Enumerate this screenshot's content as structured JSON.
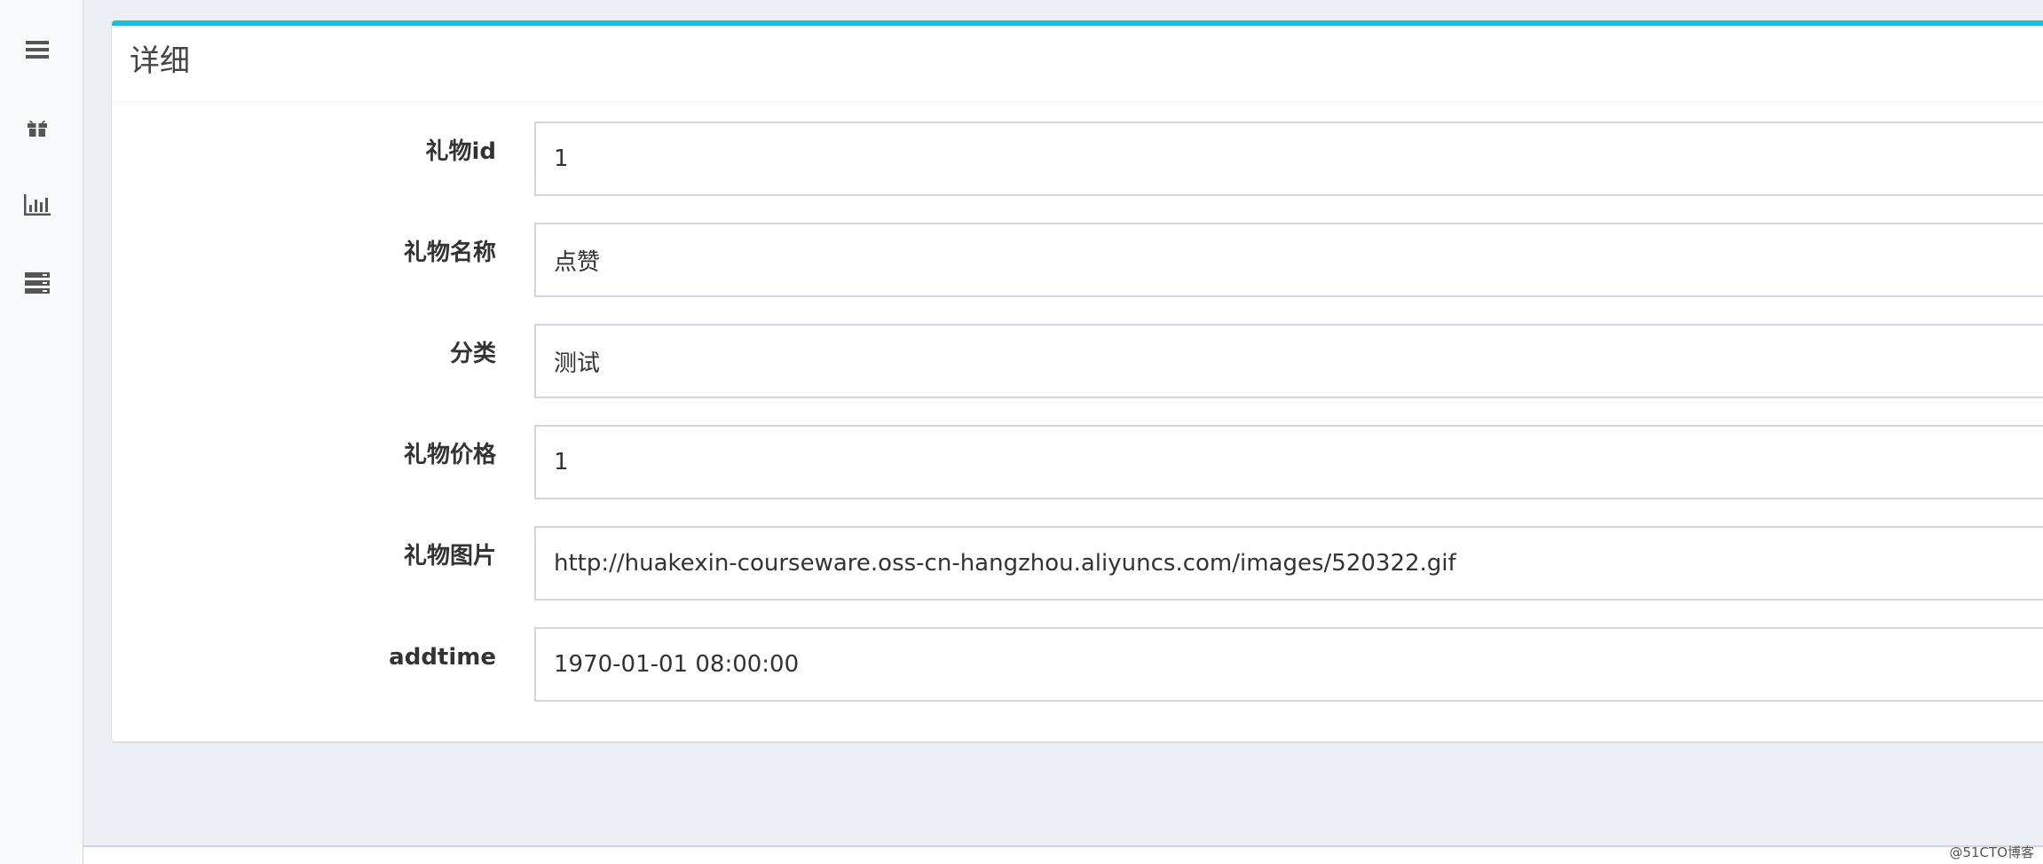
{
  "sidebar": {
    "icons": [
      "menu-icon",
      "gift-icon",
      "bar-chart-icon",
      "server-icon"
    ]
  },
  "panel": {
    "title": "详细"
  },
  "fields": [
    {
      "label": "礼物id",
      "value": "1"
    },
    {
      "label": "礼物名称",
      "value": "点赞"
    },
    {
      "label": "分类",
      "value": "测试"
    },
    {
      "label": "礼物价格",
      "value": "1"
    },
    {
      "label": "礼物图片",
      "value": "http://huakexin-courseware.oss-cn-hangzhou.aliyuncs.com/images/520322.gif"
    },
    {
      "label": "addtime",
      "value": "1970-01-01 08:00:00"
    }
  ],
  "watermark": "@51CTO博客",
  "colors": {
    "accent": "#22bcd5",
    "background": "#ecf0f5",
    "input_border": "#d2d6de"
  }
}
